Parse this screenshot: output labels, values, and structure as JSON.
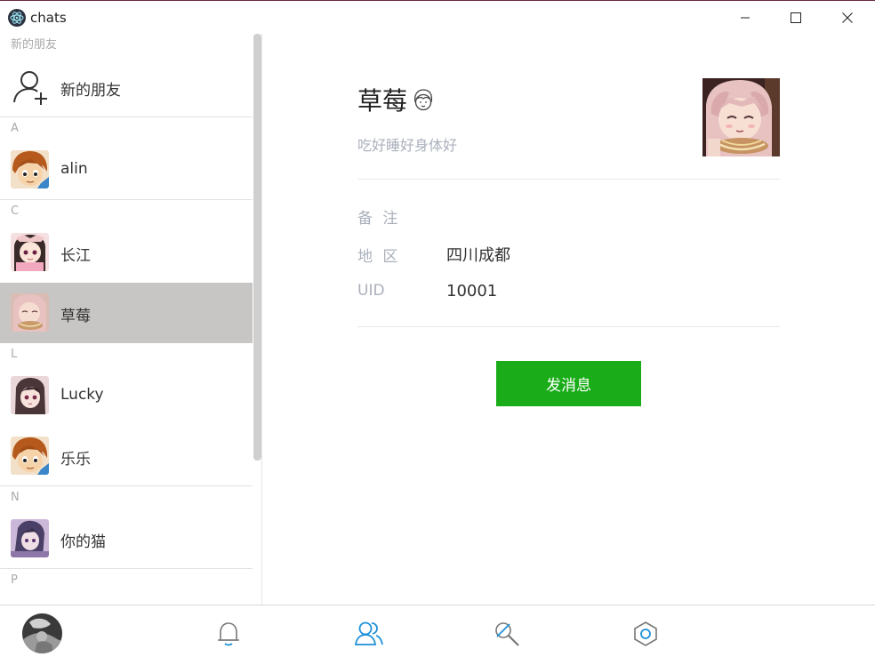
{
  "window": {
    "title": "chats",
    "minimize_icon": "minimize-icon",
    "maximize_icon": "maximize-icon",
    "close_icon": "close-icon"
  },
  "sidebar": {
    "top_section": "新的朋友",
    "new_friend_label": "新的朋友",
    "sections": [
      {
        "letter": "A",
        "contacts": [
          {
            "name": "alin",
            "avatar": "boy-avatar"
          }
        ]
      },
      {
        "letter": "C",
        "contacts": [
          {
            "name": "长江",
            "avatar": "girl-pink-avatar"
          },
          {
            "name": "草莓",
            "avatar": "girl-eating-avatar",
            "selected": true
          }
        ]
      },
      {
        "letter": "L",
        "contacts": [
          {
            "name": "Lucky",
            "avatar": "anime-girl-avatar"
          },
          {
            "name": "乐乐",
            "avatar": "boy-avatar"
          }
        ]
      },
      {
        "letter": "N",
        "contacts": [
          {
            "name": "你的猫",
            "avatar": "purple-anime-avatar"
          }
        ]
      },
      {
        "letter": "P",
        "contacts": []
      }
    ]
  },
  "profile": {
    "name": "草莓",
    "gender_icon": "female-face-icon",
    "signature": "吃好睡好身体好",
    "remark_label": "备 注",
    "remark_value": "",
    "region_label": "地 区",
    "region_value": "四川成都",
    "uid_label": "UID",
    "uid_value": "10001",
    "send_button": "发消息"
  },
  "bottom_nav": {
    "items": [
      "bell-icon",
      "contacts-icon",
      "search-tool-icon",
      "settings-hex-icon"
    ],
    "active": "contacts-icon",
    "accent_color": "#1e90d8",
    "icon_color": "#7a7a7a"
  },
  "colors": {
    "selected_row": "#c8c6c4",
    "send_button": "#1aad19"
  }
}
